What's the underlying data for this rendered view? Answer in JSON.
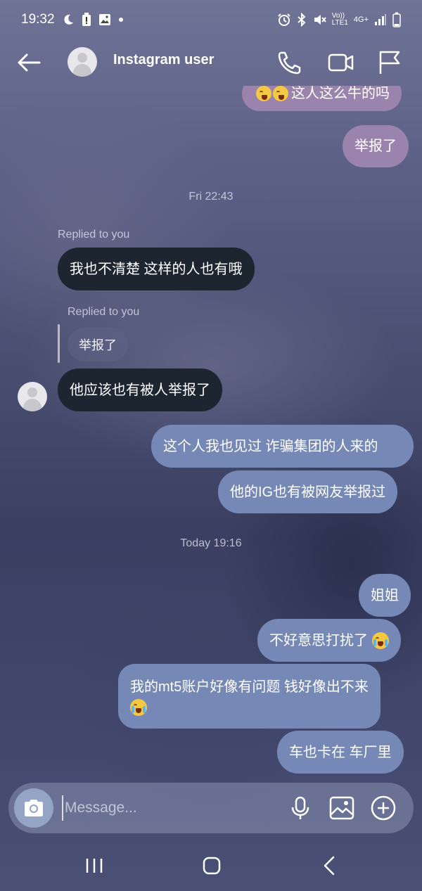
{
  "status_bar": {
    "time": "19:32",
    "network_label_top": "Vo))",
    "network_label_bottom": "LTE1",
    "network_type": "4G+",
    "icons": [
      "moon-icon",
      "battery-alert-icon",
      "gallery-icon",
      "dot-icon",
      "alarm-icon",
      "bluetooth-icon",
      "mute-icon",
      "signal-icon",
      "battery-icon"
    ]
  },
  "header": {
    "title": "Instagram user",
    "icons": [
      "back-arrow-icon",
      "phone-icon",
      "video-call-icon",
      "flag-icon"
    ]
  },
  "messages": {
    "partial_top": "这人这么牛的吗",
    "m1": "举报了",
    "ts1": "Fri 22:43",
    "replied1": "Replied to you",
    "in1": "我也不清楚 这样的人也有哦",
    "replied2": "Replied to you",
    "quote2": "举报了",
    "in2": "他应该也有被人举报了",
    "out1": "这个人我也见过 诈骗集团的人来的",
    "out2": "他的IG也有被网友举报过",
    "ts2": "Today 19:16",
    "out3": "姐姐",
    "out4": "不好意思打扰了",
    "out5_line1": "我的mt5账户好像有问题 钱好像出不来",
    "out6": "车也卡在 车厂里"
  },
  "composer": {
    "placeholder": "Message...",
    "icons": [
      "camera-icon",
      "microphone-icon",
      "image-icon",
      "add-icon"
    ]
  },
  "navbar": {
    "icons": [
      "recent-apps-icon",
      "home-icon",
      "back-icon"
    ]
  },
  "colors": {
    "outgoing_bubble": "#7688b6",
    "incoming_bubble": "#1c2530",
    "purple_bubble": "#9a84ad"
  }
}
